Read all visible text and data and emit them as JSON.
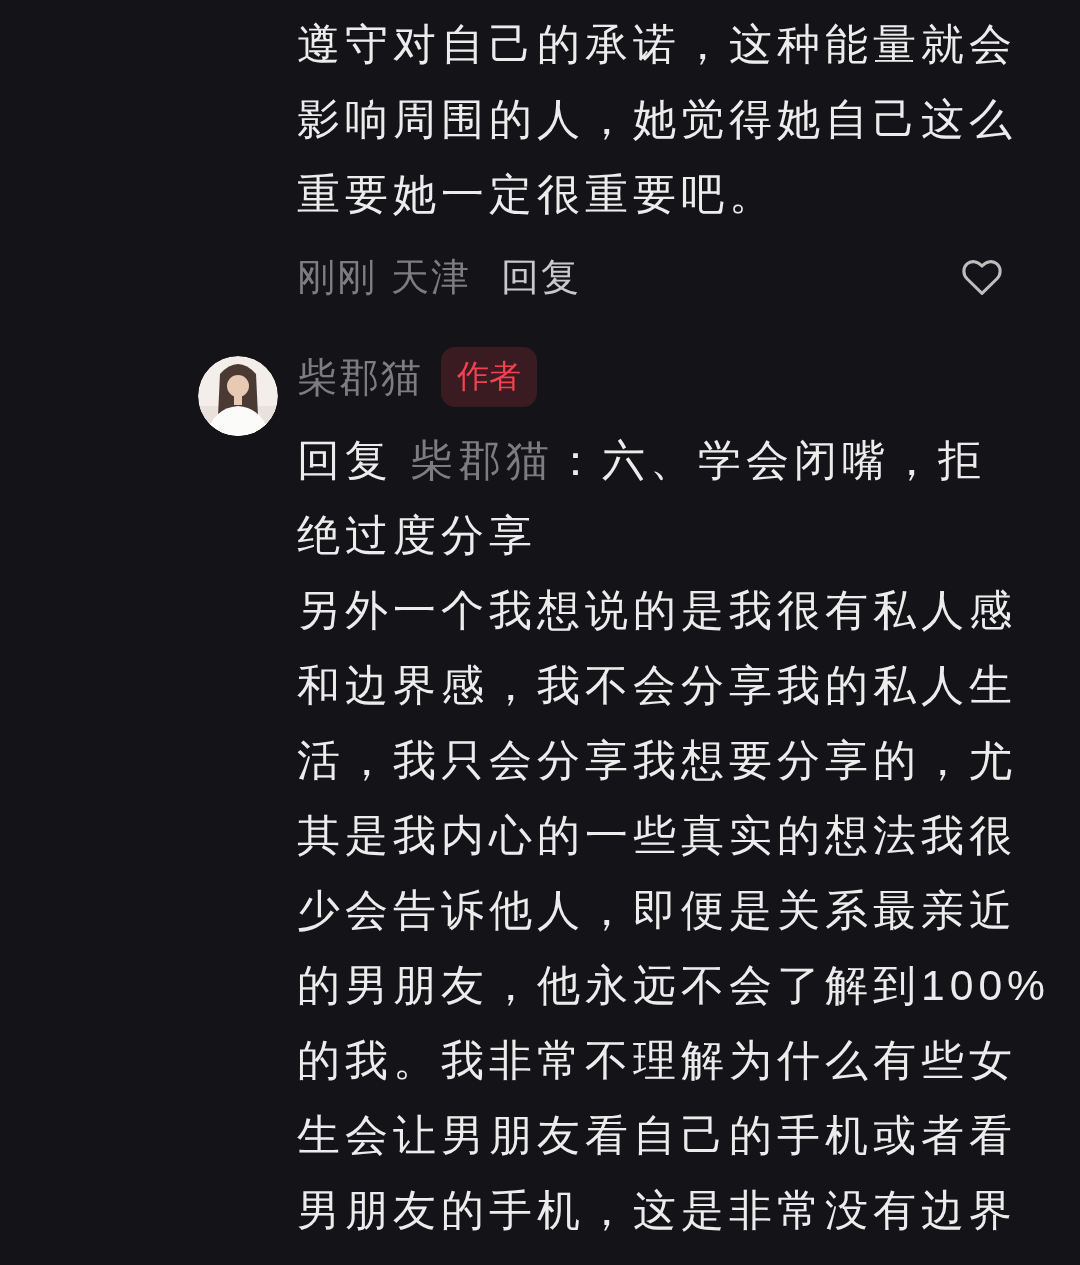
{
  "comments": [
    {
      "text": "遵守对自己的承诺，这种能量就会影响周围的人，她觉得她自己这么重要她一定很重要吧。",
      "time": "刚刚",
      "location": "天津",
      "reply_button": "回复"
    },
    {
      "author": "柴郡猫",
      "badge": "作者",
      "reply_label": "回复",
      "reply_to": "柴郡猫",
      "reply_text": "：六、学会闭嘴，拒绝过度分享",
      "text": "另外一个我想说的是我很有私人感和边界感，我不会分享我的私人生活，我只会分享我想要分享的，尤其是我内心的一些真实的想法我很少会告诉他人，即便是关系最亲近的男朋友，他永远不会了解到100%的我。我非常不理解为什么有些女生会让男朋友看自己的手机或者看男朋友的手机，这是非常没有边界"
    }
  ]
}
